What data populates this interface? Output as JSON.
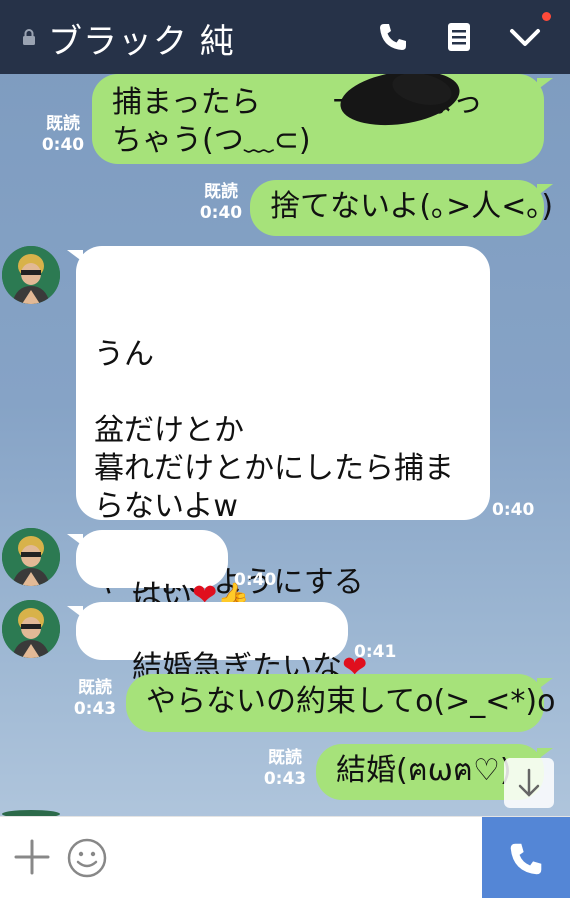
{
  "header": {
    "title": "ブラック 純",
    "icons": [
      "lock-icon",
      "phone-icon",
      "menu-note-icon",
      "chevron-down-icon"
    ],
    "notification_color": "#ff4a3a"
  },
  "colors": {
    "mine_bubble": "#a6e27a",
    "header": "#263248",
    "call_button": "#5486d6",
    "heart": "#e00f1e"
  },
  "messages": {
    "m1": {
      "text_line1": "捕まったら",
      "text_line1b": "一人になっ",
      "text_line2": "ちゃう(つ﹏⊂)",
      "read": "既読",
      "time": "0:40"
    },
    "m2": {
      "text": "捨てないよ(｡>人<｡)",
      "read": "既読",
      "time": "0:40"
    },
    "m3": {
      "text": "うん\n\n盆だけとか\n暮れだけとかにしたら捕ま\nらないよw\n\nやらないようにする",
      "time": "0:40"
    },
    "m4": {
      "text": "はい",
      "heart": "❤",
      "thumb": "👍",
      "time": "0:40"
    },
    "m5": {
      "text": "結婚急ぎたいな",
      "heart": "❤",
      "time": "0:41"
    },
    "m6": {
      "text": "やらないの約束してo(>_<*)o",
      "read": "既読",
      "time": "0:43"
    },
    "m7": {
      "text": "結婚(ฅωฅ♡)",
      "read": "既読",
      "time": "0:43"
    }
  },
  "input": {
    "icons": [
      "plus-icon",
      "smiley-icon",
      "call-icon"
    ]
  }
}
